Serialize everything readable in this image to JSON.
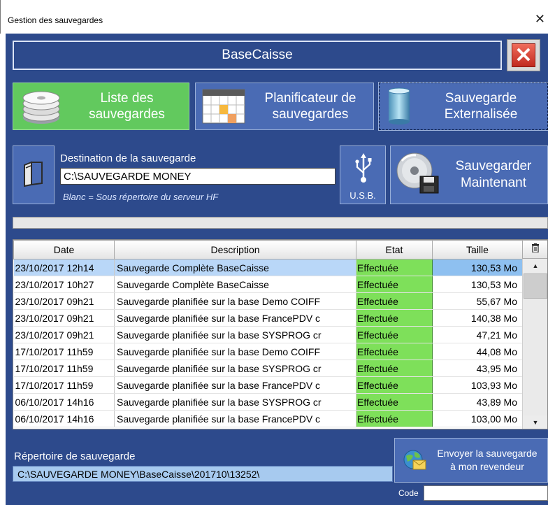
{
  "window": {
    "title": "Gestion des sauvegardes",
    "close_glyph": "✕"
  },
  "header": {
    "title": "BaseCaisse",
    "close_glyph": "✕"
  },
  "tabs": [
    {
      "line1": "Liste des",
      "line2": "sauvegardes",
      "icon": "disk-stack-icon"
    },
    {
      "line1": "Planificateur de",
      "line2": "sauvegardes",
      "icon": "calendar-icon"
    },
    {
      "line1": "Sauvegarde",
      "line2": "Externalisée",
      "icon": "cylinder-icon"
    }
  ],
  "destination": {
    "label": "Destination de la sauvegarde",
    "value": "C:\\SAUVEGARDE MONEY",
    "hint": "Blanc = Sous répertoire du serveur HF"
  },
  "usb": {
    "label": "U.S.B."
  },
  "save_now": {
    "line1": "Sauvegarder",
    "line2": "Maintenant"
  },
  "progress": {
    "value": 0
  },
  "table": {
    "columns": [
      "Date",
      "Description",
      "Etat",
      "Taille"
    ],
    "rows": [
      [
        "23/10/2017 12h14",
        "Sauvegarde Complète BaseCaisse",
        "Effectuée",
        "130,53 Mo"
      ],
      [
        "23/10/2017 10h27",
        "Sauvegarde Complète BaseCaisse",
        "Effectuée",
        "130,53 Mo"
      ],
      [
        "23/10/2017 09h21",
        "Sauvegarde planifiée sur la base Demo COIFF",
        "Effectuée",
        "55,67 Mo"
      ],
      [
        "23/10/2017 09h21",
        "Sauvegarde planifiée sur la base FrancePDV c",
        "Effectuée",
        "140,38 Mo"
      ],
      [
        "23/10/2017 09h21",
        "Sauvegarde planifiée sur la base SYSPROG cr",
        "Effectuée",
        "47,21 Mo"
      ],
      [
        "17/10/2017 11h59",
        "Sauvegarde planifiée sur la base Demo COIFF",
        "Effectuée",
        "44,08 Mo"
      ],
      [
        "17/10/2017 11h59",
        "Sauvegarde planifiée sur la base SYSPROG cr",
        "Effectuée",
        "43,95 Mo"
      ],
      [
        "17/10/2017 11h59",
        "Sauvegarde planifiée sur la base FrancePDV c",
        "Effectuée",
        "103,93 Mo"
      ],
      [
        "06/10/2017 14h16",
        "Sauvegarde planifiée sur la base SYSPROG cr",
        "Effectuée",
        "43,89 Mo"
      ],
      [
        "06/10/2017 14h16",
        "Sauvegarde planifiée sur la base FrancePDV c",
        "Effectuée",
        "103,00 Mo"
      ]
    ],
    "selected_row": 0,
    "delete_icon": "trash-icon"
  },
  "repertoire": {
    "label": "Répertoire de sauvegarde",
    "value": "C:\\SAUVEGARDE MONEY\\BaseCaisse\\201710\\13252\\"
  },
  "send": {
    "line1": "Envoyer la sauvegarde",
    "line2": "à mon revendeur"
  },
  "code": {
    "label": "Code",
    "value": ""
  },
  "colors": {
    "background": "#2d4a8c",
    "button": "#4a6bb4",
    "active_tab": "#62c95e",
    "status_ok": "#7ee05a",
    "selection": "#b9d7f8"
  }
}
